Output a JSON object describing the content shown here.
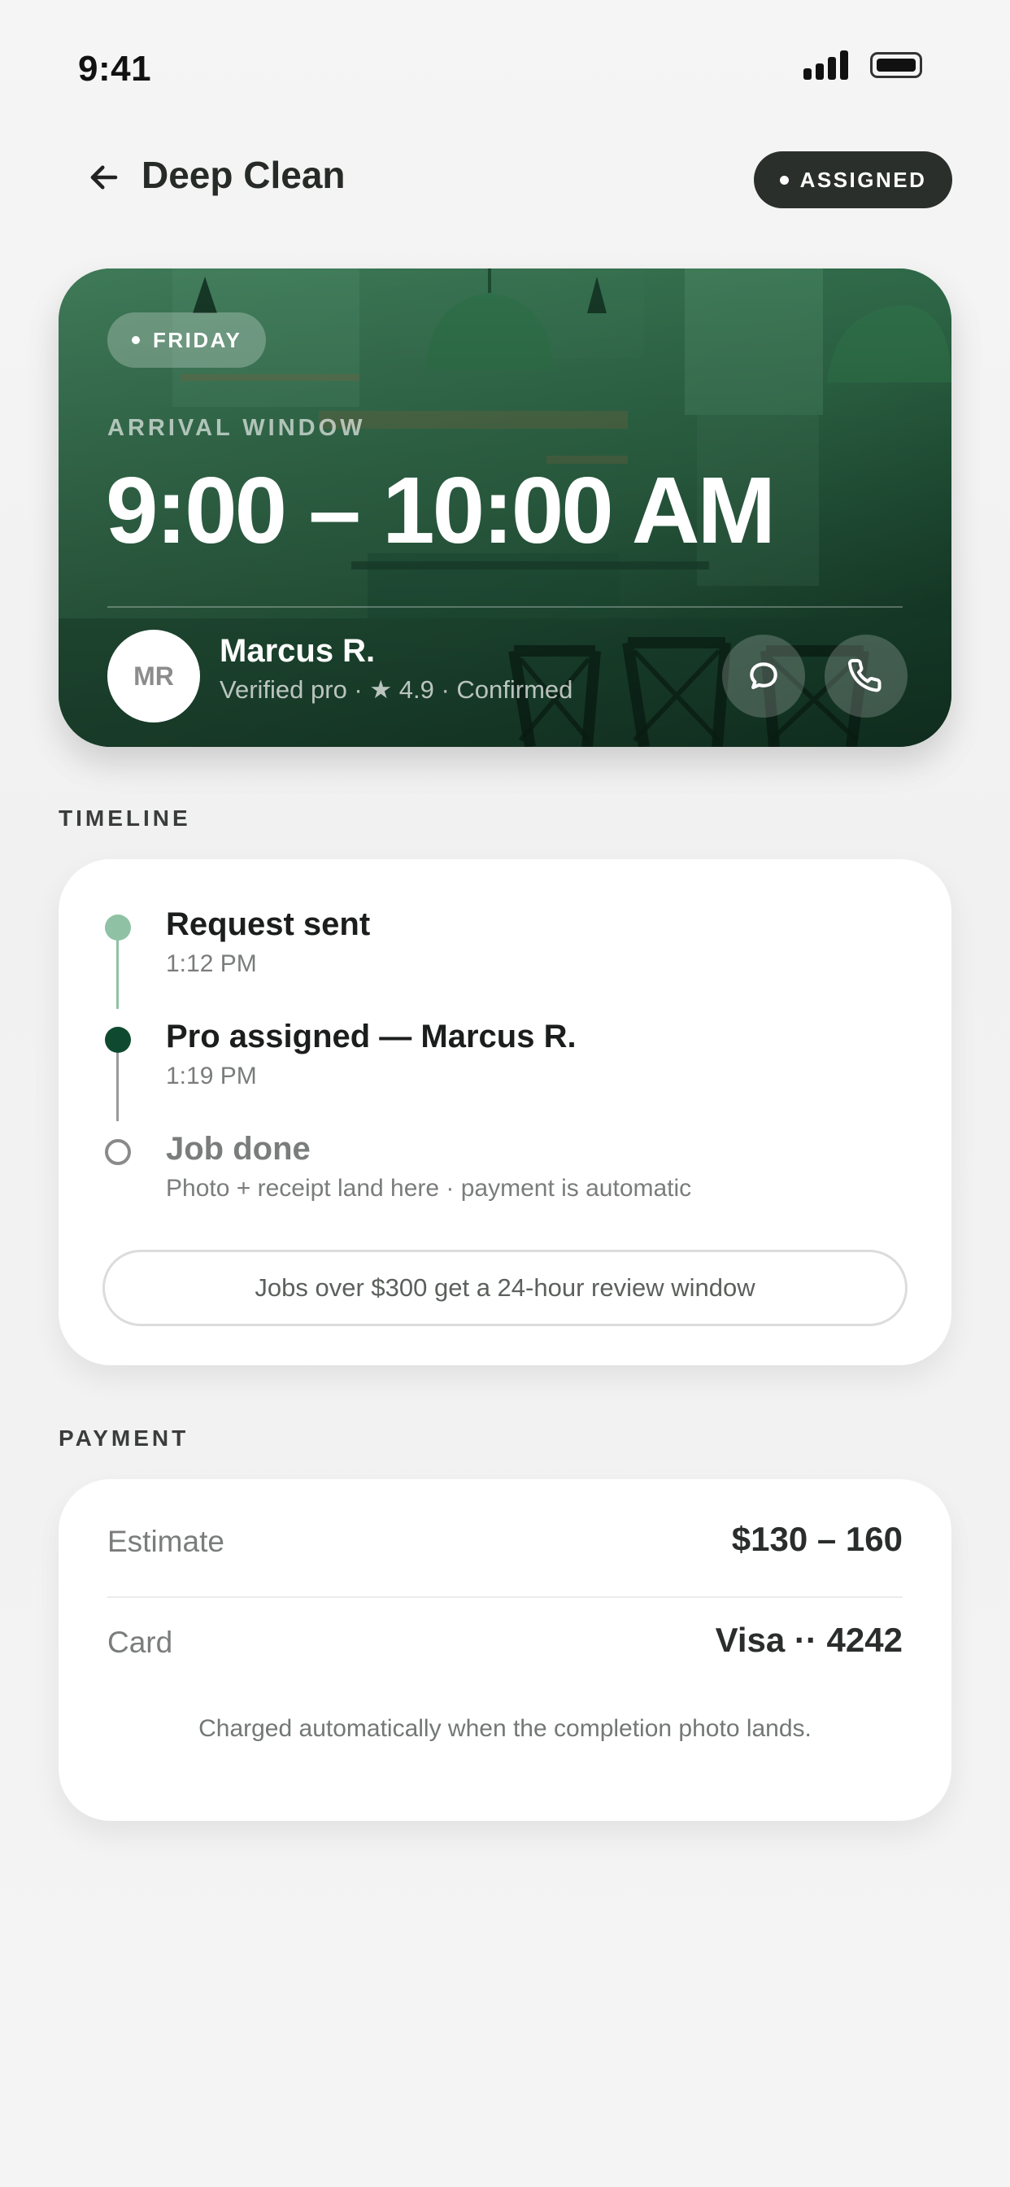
{
  "status_bar": {
    "time": "9:41"
  },
  "header": {
    "title": "Deep Clean",
    "status_badge": "ASSIGNED"
  },
  "hero": {
    "day": "FRIDAY",
    "arrival_label": "ARRIVAL WINDOW",
    "arrival_time": "9:00 – 10:00 AM",
    "pro": {
      "initials": "MR",
      "name": "Marcus R.",
      "meta": "Verified pro · ★ 4.9 · Confirmed"
    }
  },
  "timeline": {
    "section_label": "TIMELINE",
    "steps": [
      {
        "title": "Request sent",
        "subtitle": "1:12 PM",
        "state": "done"
      },
      {
        "title": "Pro assigned — Marcus R.",
        "subtitle": "1:19 PM",
        "state": "current"
      },
      {
        "title": "Job done",
        "subtitle": "Photo + receipt land here · payment is automatic",
        "state": "pending"
      }
    ],
    "review_note": "Jobs over $300 get a 24-hour review window"
  },
  "payment": {
    "section_label": "PAYMENT",
    "estimate_label": "Estimate",
    "estimate_value": "$130 – 160",
    "card_label": "Card",
    "card_value": "Visa ·· 4242",
    "note": "Charged automatically when the completion photo lands."
  },
  "colors": {
    "accent_dark": "#0f4a30",
    "accent_light": "#8fc2a4",
    "hero_green": "#2f6a48",
    "badge_bg": "#2a2f2c"
  }
}
